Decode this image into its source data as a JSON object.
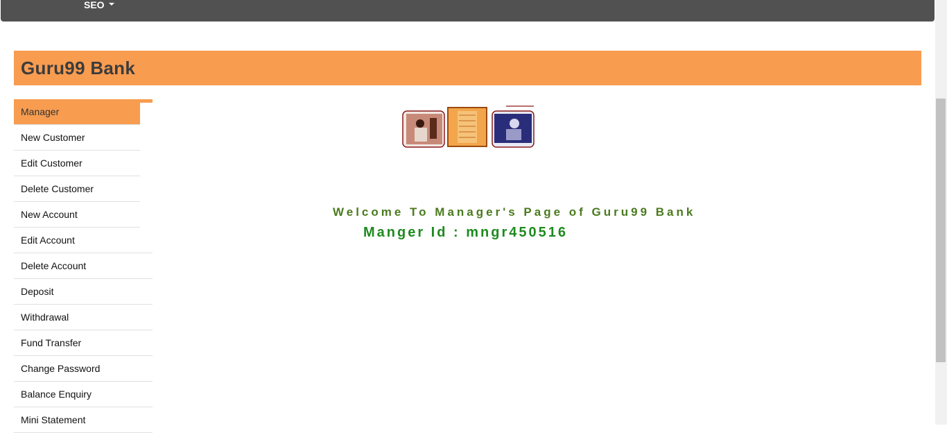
{
  "topnav": {
    "seo_label": "SEO"
  },
  "header": {
    "title": "Guru99 Bank"
  },
  "sidebar": {
    "items": [
      {
        "label": "Manager",
        "active": true
      },
      {
        "label": "New Customer"
      },
      {
        "label": "Edit Customer"
      },
      {
        "label": "Delete Customer"
      },
      {
        "label": "New Account"
      },
      {
        "label": "Edit Account"
      },
      {
        "label": "Delete Account"
      },
      {
        "label": "Deposit"
      },
      {
        "label": "Withdrawal"
      },
      {
        "label": "Fund Transfer"
      },
      {
        "label": "Change Password"
      },
      {
        "label": "Balance Enquiry"
      },
      {
        "label": "Mini Statement"
      }
    ]
  },
  "main": {
    "welcome": "Welcome To Manager's Page of Guru99 Bank",
    "manager_id": "Manger Id : mngr450516"
  },
  "colors": {
    "accent": "#f89c50",
    "nav_bg": "#515151",
    "welcome_text": "#4a7a1e",
    "manager_id_text": "#1f8a1f"
  }
}
